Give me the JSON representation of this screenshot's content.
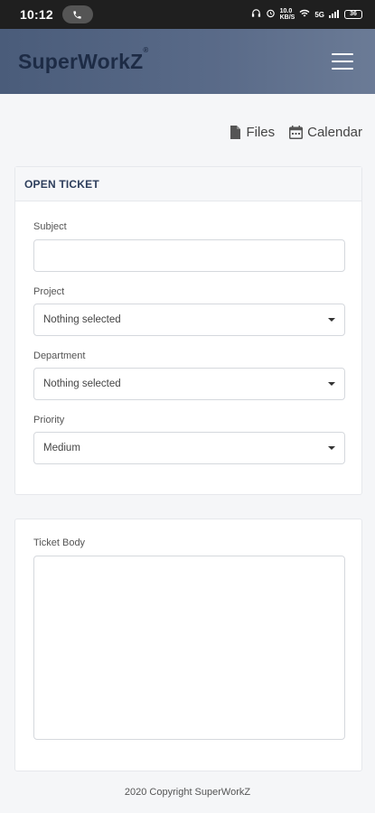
{
  "status_bar": {
    "time": "10:12",
    "call_icon": "phone-icon",
    "data_speed": "10.0",
    "data_unit": "KB/S",
    "network": "5G",
    "battery": "36"
  },
  "header": {
    "brand": "SuperWorkZ",
    "trademark": "®",
    "menu_icon": "hamburger-icon"
  },
  "shortcuts": {
    "files_label": "Files",
    "files_icon": "file-icon",
    "calendar_label": "Calendar",
    "calendar_icon": "calendar-icon"
  },
  "ticket_form": {
    "title": "OPEN TICKET",
    "subject_label": "Subject",
    "subject_value": "",
    "project_label": "Project",
    "project_value": "Nothing selected",
    "department_label": "Department",
    "department_value": "Nothing selected",
    "priority_label": "Priority",
    "priority_value": "Medium"
  },
  "ticket_body": {
    "label": "Ticket Body",
    "value": ""
  },
  "footer": {
    "copyright": "2020 Copyright SuperWorkZ"
  }
}
